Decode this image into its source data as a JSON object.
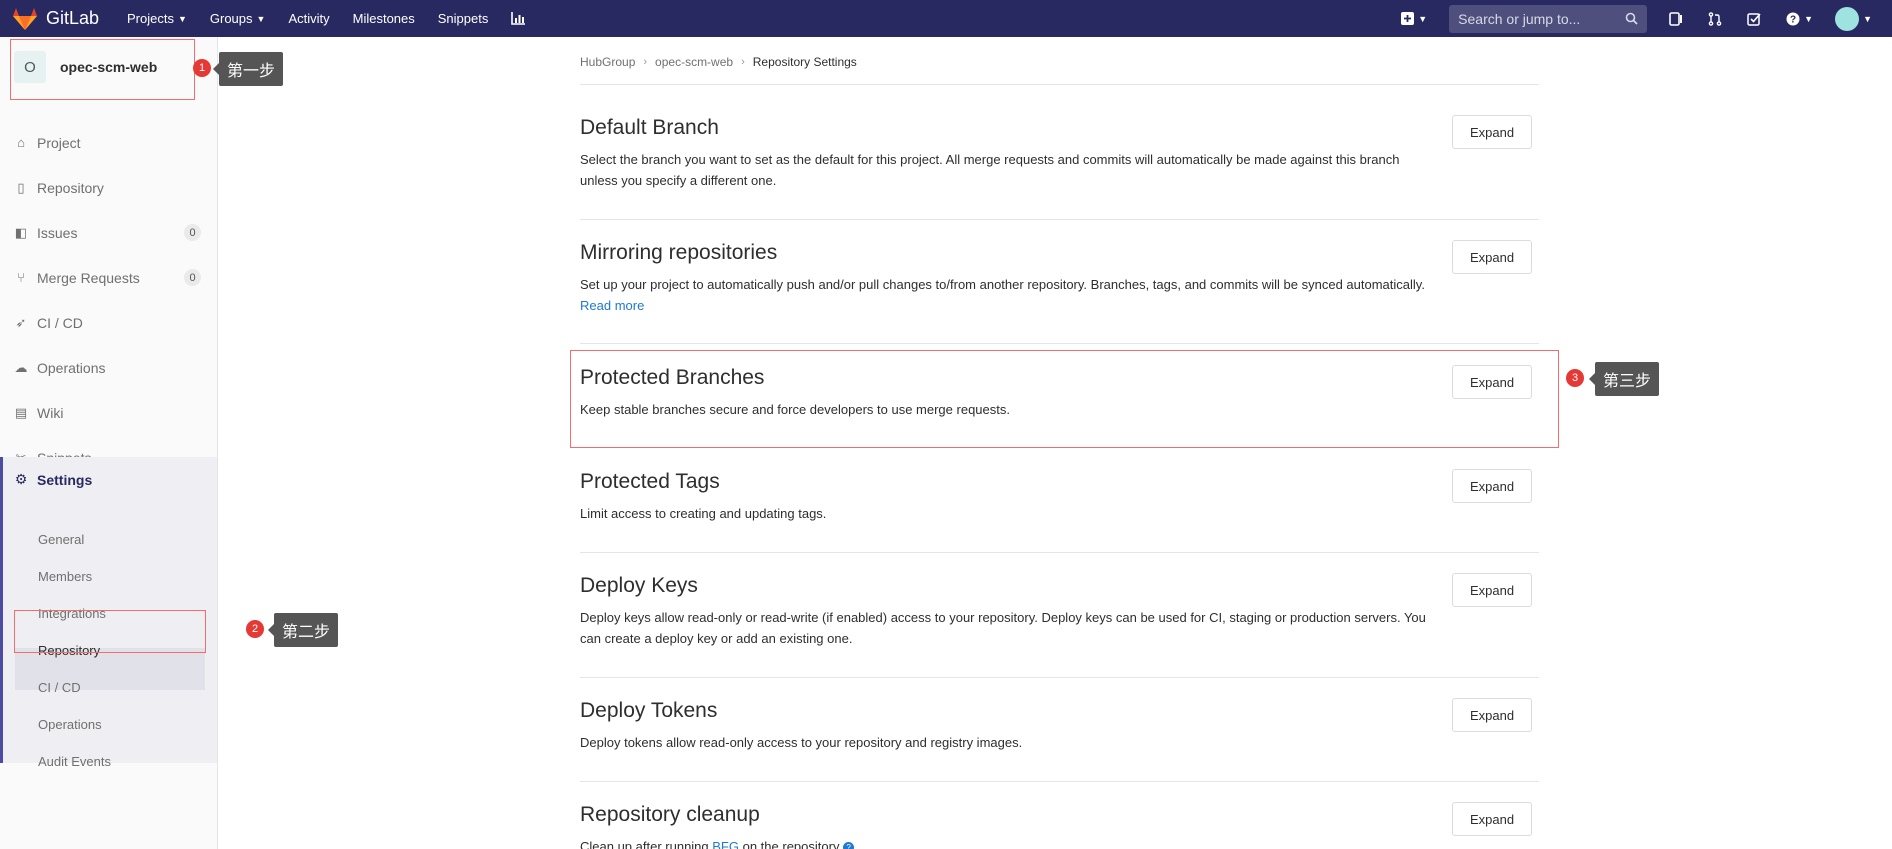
{
  "app": {
    "name": "GitLab"
  },
  "topnav": {
    "links": [
      {
        "label": "Projects",
        "dropdown": true
      },
      {
        "label": "Groups",
        "dropdown": true
      },
      {
        "label": "Activity",
        "dropdown": false
      },
      {
        "label": "Milestones",
        "dropdown": false
      },
      {
        "label": "Snippets",
        "dropdown": false
      }
    ],
    "search_placeholder": "Search or jump to...",
    "icons": [
      "chart-icon",
      "plus-square-icon",
      "issues-icon",
      "merge-request-icon",
      "todo-icon",
      "help-icon",
      "user-avatar"
    ]
  },
  "sidebar": {
    "project_initial": "O",
    "project_name": "opec-scm-web",
    "items": [
      {
        "label": "Project",
        "icon": "home-icon"
      },
      {
        "label": "Repository",
        "icon": "book-icon"
      },
      {
        "label": "Issues",
        "icon": "issues-icon",
        "count": "0"
      },
      {
        "label": "Merge Requests",
        "icon": "merge-request-icon",
        "count": "0"
      },
      {
        "label": "CI / CD",
        "icon": "rocket-icon"
      },
      {
        "label": "Operations",
        "icon": "cloud-icon"
      },
      {
        "label": "Wiki",
        "icon": "wiki-icon"
      },
      {
        "label": "Snippets",
        "icon": "scissors-icon"
      }
    ],
    "settings": {
      "label": "Settings",
      "icon": "gear-icon",
      "sub_items": [
        "General",
        "Members",
        "Integrations",
        "Repository",
        "CI / CD",
        "Operations",
        "Audit Events"
      ],
      "active": "Repository"
    }
  },
  "breadcrumb": [
    "HubGroup",
    "opec-scm-web",
    "Repository Settings"
  ],
  "sections": [
    {
      "title": "Default Branch",
      "desc": "Select the branch you want to set as the default for this project. All merge requests and commits will automatically be made against this branch unless you specify a different one.",
      "button": "Expand"
    },
    {
      "title": "Mirroring repositories",
      "desc": "Set up your project to automatically push and/or pull changes to/from another repository. Branches, tags, and commits will be synced automatically.",
      "link": "Read more",
      "button": "Expand"
    },
    {
      "title": "Protected Branches",
      "desc": "Keep stable branches secure and force developers to use merge requests.",
      "button": "Expand"
    },
    {
      "title": "Protected Tags",
      "desc": "Limit access to creating and updating tags.",
      "button": "Expand"
    },
    {
      "title": "Deploy Keys",
      "desc": "Deploy keys allow read-only or read-write (if enabled) access to your repository. Deploy keys can be used for CI, staging or production servers. You can create a deploy key or add an existing one.",
      "button": "Expand"
    },
    {
      "title": "Deploy Tokens",
      "desc": "Deploy tokens allow read-only access to your repository and registry images.",
      "button": "Expand"
    },
    {
      "title": "Repository cleanup",
      "desc_prefix": "Clean up after running ",
      "link": "BFG",
      "desc_suffix": " on the repository",
      "button": "Expand"
    }
  ],
  "annotations": [
    {
      "number": "1",
      "label": "第一步"
    },
    {
      "number": "2",
      "label": "第二步"
    },
    {
      "number": "3",
      "label": "第三步"
    }
  ],
  "colors": {
    "navbar": "#292961",
    "link": "#1f78d1",
    "annotation_red": "#e53935",
    "annotation_tag": "#555555"
  }
}
